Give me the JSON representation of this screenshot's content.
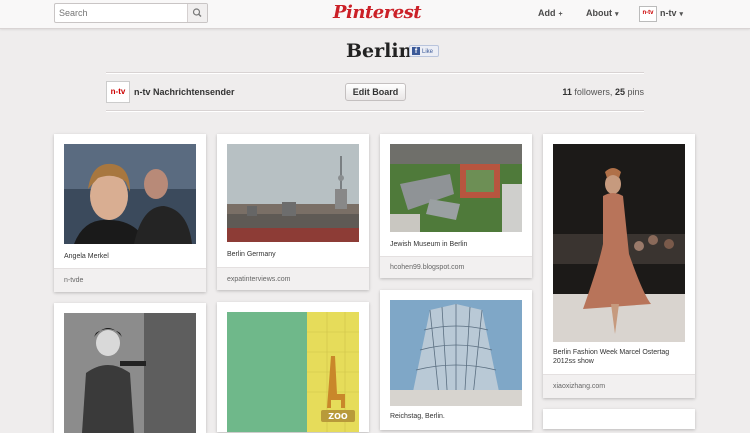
{
  "header": {
    "search_placeholder": "Search",
    "logo": "Pinterest",
    "nav": [
      {
        "label": "Add",
        "caret": "+"
      },
      {
        "label": "About",
        "caret": "▾"
      },
      {
        "label": "n-tv",
        "caret": "▾"
      }
    ],
    "user_avatar_text": "n-tv"
  },
  "board": {
    "title": "Berlin",
    "like_label": "Like",
    "owner_avatar_text": "n-tv",
    "owner_name": "n-tv Nachrichtensender",
    "edit_label": "Edit Board",
    "followers_count": "11",
    "followers_label": "followers,",
    "pins_count": "25",
    "pins_label": "pins"
  },
  "pins": [
    {
      "caption": "Angela Merkel",
      "source": "n-tvde"
    },
    {
      "caption": "Berlin Germany",
      "source": "expatinterviews.com"
    },
    {
      "caption": "Jewish Museum in Berlin",
      "source": "hcohen99.blogspot.com"
    },
    {
      "caption": "Berlin Fashion Week Marcel Ostertag 2012ss show",
      "source": "xiaoxizhang.com"
    },
    {
      "caption": "",
      "source": ""
    },
    {
      "caption": "",
      "source": ""
    },
    {
      "caption": "Reichstag, Berlin.",
      "source": ""
    }
  ],
  "colors": {
    "brand": "#cb2027",
    "background": "#efeded"
  }
}
